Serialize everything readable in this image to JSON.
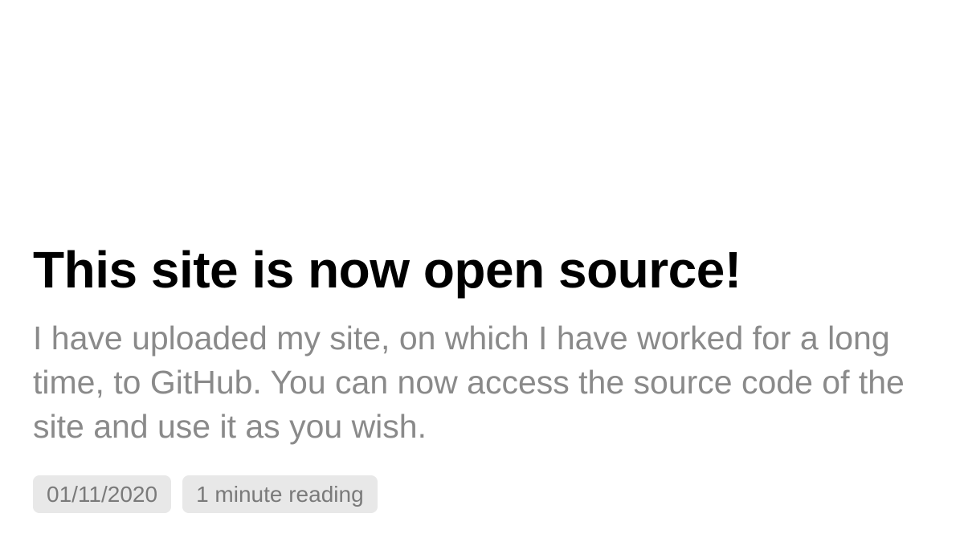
{
  "post": {
    "title": "This site is now open source!",
    "description": "I have uploaded my site, on which I have worked for a long time, to GitHub. You can now access the source code of the site and use it as you wish.",
    "date": "01/11/2020",
    "reading_time": "1 minute reading"
  },
  "colors": {
    "background": "#ffffff",
    "title": "#000000",
    "description": "#8a8a8a",
    "badge_background": "#e8e8e8",
    "badge_text": "#7a7a7a"
  }
}
